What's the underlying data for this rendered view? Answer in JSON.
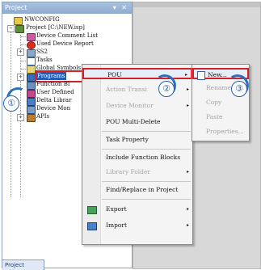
{
  "panel": {
    "title": "Project",
    "controls": "▾ ✕",
    "bottom_tab": "Project"
  },
  "tree": {
    "root": "NWCONFIG",
    "project": "Project [C:\\NEW.isp]",
    "items": [
      "Device Comment List",
      "Used Device Report",
      "SS2",
      "Tasks",
      "Global Symbols",
      "Programs",
      "Function Bl",
      "User Defined",
      "Delta Librar",
      "Device Mon",
      "APIs"
    ]
  },
  "context_menu": {
    "items": [
      {
        "label": "POU",
        "arrow": "▸",
        "disabled": false
      },
      {
        "label": "Action Transi",
        "arrow": "▸",
        "disabled": true
      },
      {
        "label": "Device Monitor",
        "arrow": "▸",
        "disabled": true
      },
      {
        "label": "POU Multi-Delete",
        "arrow": "",
        "disabled": false
      },
      {
        "label": "Task Property",
        "arrow": "",
        "disabled": false
      },
      {
        "label": "Include Function Blocks",
        "arrow": "",
        "disabled": false
      },
      {
        "label": "Library Folder",
        "arrow": "▸",
        "disabled": true
      },
      {
        "label": "Find/Replace in Project",
        "arrow": "",
        "disabled": false
      },
      {
        "label": "Export",
        "arrow": "▸",
        "disabled": false
      },
      {
        "label": "Import",
        "arrow": "▸",
        "disabled": false
      }
    ]
  },
  "submenu": {
    "items": [
      "New...",
      "Rename",
      "Copy",
      "Paste",
      "Properties..."
    ]
  },
  "callouts": [
    "①",
    "②",
    "③"
  ],
  "colors": {
    "highlight": "#d4202a",
    "callout": "#2a5d9f",
    "panel_header": "#8eabce"
  }
}
